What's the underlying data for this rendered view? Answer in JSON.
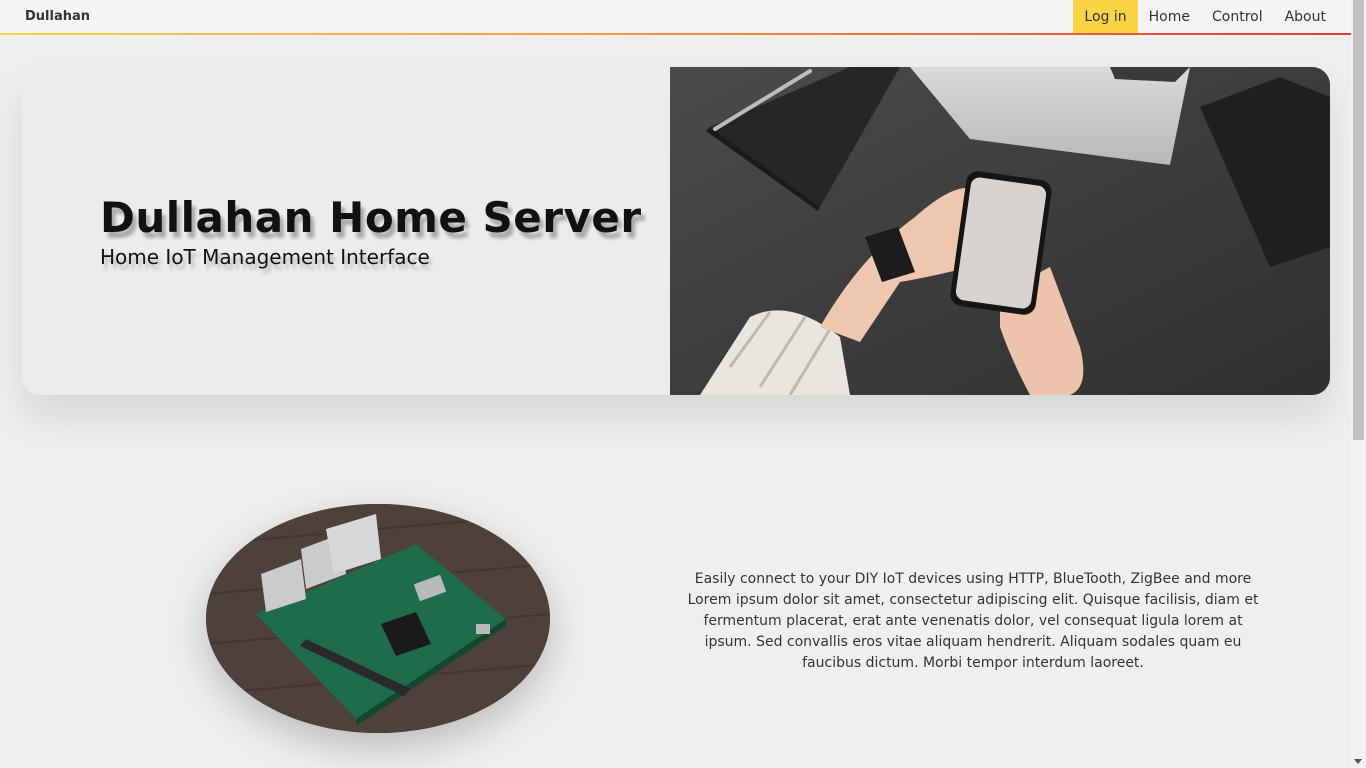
{
  "navbar": {
    "brand": "Dullahan",
    "links": [
      {
        "label": "Log in"
      },
      {
        "label": "Home"
      },
      {
        "label": "Control"
      },
      {
        "label": "About"
      }
    ]
  },
  "hero": {
    "title": "Dullahan Home Server",
    "subtitle": "Home IoT Management Interface"
  },
  "feature": {
    "text": "Easily connect to your DIY IoT devices using HTTP, BlueTooth, ZigBee and more Lorem ipsum dolor sit amet, consectetur adipiscing elit. Quisque facilisis, diam et fermentum placerat, erat ante venenatis dolor, vel consequat ligula lorem at ipsum. Sed convallis eros vitae aliquam hendrerit. Aliquam sodales quam eu faucibus dictum. Morbi tempor interdum laoreet."
  },
  "colors": {
    "accent": "#fbd444",
    "gradient_start": "#f7d04a",
    "gradient_end": "#e03a3a"
  }
}
